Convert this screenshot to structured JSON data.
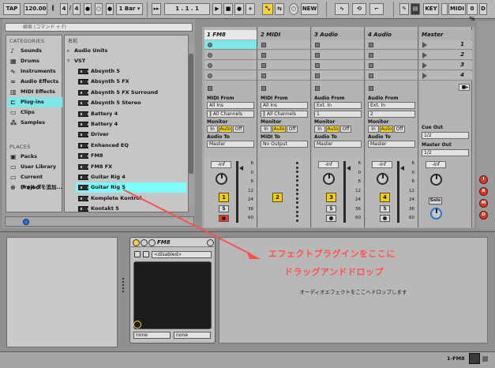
{
  "transport": {
    "tap": "TAP",
    "tempo": "120.00",
    "sig_num": "4",
    "sig_sep": "/",
    "sig_den": "4",
    "quantize": "1 Bar",
    "pos_bar": "1",
    "pos_beat": "1",
    "pos_sixteenth": "1",
    "new_label": "NEW",
    "key_label": "KEY",
    "midi_label": "MIDI",
    "cpu_label": "0 %",
    "disk_label": "D"
  },
  "browser": {
    "search_placeholder": "検索 (コマンド + F)",
    "categories_header": "CATEGORIES",
    "categories": [
      {
        "label": "Sounds",
        "icon": "music-note-icon"
      },
      {
        "label": "Drums",
        "icon": "drum-grid-icon"
      },
      {
        "label": "Instruments",
        "icon": "waveform-icon"
      },
      {
        "label": "Audio Effects",
        "icon": "audio-wave-icon"
      },
      {
        "label": "MIDI Effects",
        "icon": "midi-plug-icon"
      },
      {
        "label": "Plug-ins",
        "icon": "plug-icon"
      },
      {
        "label": "Clips",
        "icon": "clip-icon"
      },
      {
        "label": "Samples",
        "icon": "samples-icon"
      }
    ],
    "places_header": "PLACES",
    "places": [
      {
        "label": "Packs",
        "icon": "packs-icon"
      },
      {
        "label": "User Library",
        "icon": "folder-icon"
      },
      {
        "label": "Current Project",
        "icon": "folder-icon"
      },
      {
        "label": "フォルダを追加...",
        "icon": "add-folder-icon"
      }
    ],
    "list_header": "名前",
    "groups": [
      {
        "label": "Audio Units",
        "expanded": false
      },
      {
        "label": "VST",
        "expanded": true
      }
    ],
    "plugins": [
      "Absynth 5",
      "Absynth 5 FX",
      "Absynth 5 FX Surround",
      "Absynth 5 Stereo",
      "Battery 4",
      "Battery 4",
      "Driver",
      "Enhanced EQ",
      "FM8",
      "FM8 FX",
      "Guitar Rig 4",
      "Guitar Rig 5",
      "Komplete Kontrol",
      "Kontakt 5"
    ],
    "selected_plugin": "Guitar Rig 5"
  },
  "tracks": [
    {
      "name": "1 FM8",
      "midi_from": "MIDI From",
      "input": "All Ins",
      "channel": "All Channels",
      "monitor_in": "In",
      "monitor_auto": "Auto",
      "monitor_off": "Off",
      "out_label": "Audio To",
      "output": "Master",
      "volume": "-Inf",
      "number": "1",
      "solo": "S"
    },
    {
      "name": "2 MIDI",
      "midi_from": "MIDI From",
      "input": "All Ins",
      "channel": "All Channels",
      "monitor_in": "In",
      "monitor_auto": "Auto",
      "monitor_off": "Off",
      "out_label": "MIDI To",
      "output": "No Output",
      "volume": "",
      "number": "2",
      "solo": ""
    },
    {
      "name": "3 Audio",
      "midi_from": "Audio From",
      "input": "Ext. In",
      "channel": "1",
      "monitor_in": "In",
      "monitor_auto": "Auto",
      "monitor_off": "Off",
      "out_label": "Audio To",
      "output": "Master",
      "volume": "-Inf",
      "number": "3",
      "solo": "S"
    },
    {
      "name": "4 Audio",
      "midi_from": "Audio From",
      "input": "Ext. In",
      "channel": "2",
      "monitor_in": "In",
      "monitor_auto": "Auto",
      "monitor_off": "Off",
      "out_label": "Audio To",
      "output": "Master",
      "volume": "-Inf",
      "number": "4",
      "solo": "S"
    }
  ],
  "meter_ticks": [
    "6",
    "0",
    "6",
    "12",
    "24",
    "36",
    "60"
  ],
  "master": {
    "name": "Master",
    "scenes": [
      "1",
      "2",
      "3",
      "4"
    ],
    "cue_out_label": "Cue Out",
    "cue_out": "1/2",
    "master_out_label": "Master Out",
    "master_out": "1/2",
    "volume": "-Inf",
    "solo_label": "Solo"
  },
  "side_buttons": [
    "I",
    "R",
    "M",
    "D"
  ],
  "device": {
    "name": "FM8",
    "preset": "<disabled>",
    "param1": "none",
    "param2": "none"
  },
  "dropzone": {
    "hint": "オーディオエフェクトをここへドロップします",
    "annotation_line1": "エフェクトプラグインをここに",
    "annotation_line2": "ドラッグアンドドロップ"
  },
  "status": {
    "track": "1-FM8"
  },
  "colors": {
    "selection": "#7ee8e8",
    "track_number": "#f4d000",
    "arm": "#e33b2c",
    "annotation": "#ff5050"
  }
}
